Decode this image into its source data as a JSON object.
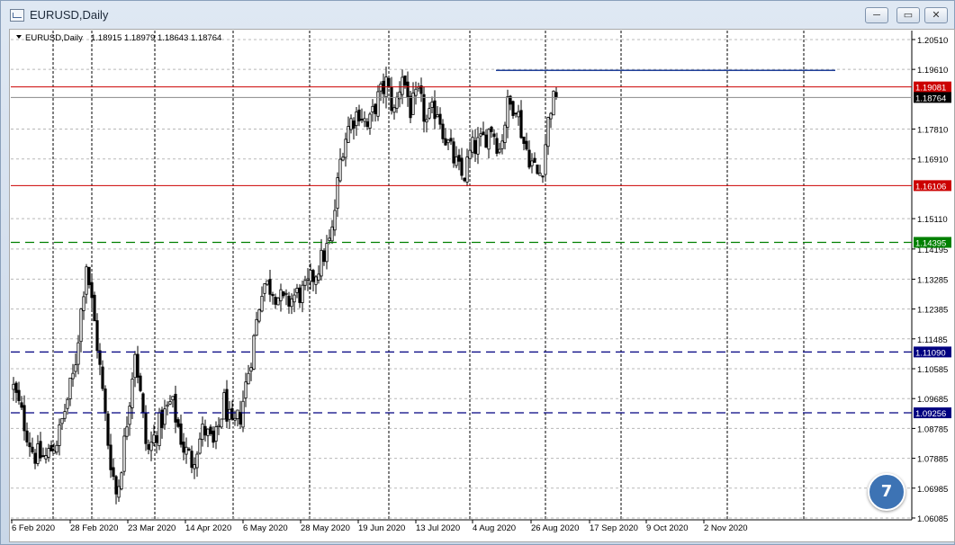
{
  "window": {
    "title": "EURUSD,Daily",
    "minimize_label": "─",
    "restore_label": "▭",
    "close_label": "✕"
  },
  "header": {
    "symbol": "EURUSD,Daily",
    "ohlc": "1.18915 1.18979 1.18643 1.18764"
  },
  "badge": {
    "label": "7"
  },
  "chart_data": {
    "type": "candlestick",
    "symbol": "EURUSD",
    "timeframe": "Daily",
    "last_bar": {
      "open": 1.18915,
      "high": 1.18979,
      "low": 1.18643,
      "close": 1.18764
    },
    "ylim": [
      1.0603,
      1.2078
    ],
    "y_ticks": [
      "1.20510",
      "1.19610",
      "1.17810",
      "1.16910",
      "1.15110",
      "1.14195",
      "1.13285",
      "1.12385",
      "1.11485",
      "1.10585",
      "1.09685",
      "1.08785",
      "1.07885",
      "1.06985",
      "1.06085"
    ],
    "x_ticks": [
      "6 Feb 2020",
      "28 Feb 2020",
      "23 Mar 2020",
      "14 Apr 2020",
      "6 May 2020",
      "28 May 2020",
      "19 Jun 2020",
      "13 Jul 2020",
      "4 Aug 2020",
      "26 Aug 2020",
      "17 Sep 2020",
      "9 Oct 2020",
      "2 Nov 2020"
    ],
    "bar_count": 202,
    "close_path": [
      [
        0,
        1.1
      ],
      [
        10,
        1.08
      ],
      [
        16,
        1.079
      ],
      [
        22,
        1.085
      ],
      [
        30,
        1.105
      ],
      [
        36,
        1.138
      ],
      [
        41,
        1.115
      ],
      [
        47,
        1.082
      ],
      [
        51,
        1.067
      ],
      [
        55,
        1.085
      ],
      [
        60,
        1.112
      ],
      [
        66,
        1.08
      ],
      [
        72,
        1.089
      ],
      [
        78,
        1.096
      ],
      [
        84,
        1.082
      ],
      [
        88,
        1.078
      ],
      [
        94,
        1.088
      ],
      [
        99,
        1.082
      ],
      [
        104,
        1.096
      ],
      [
        108,
        1.087
      ],
      [
        112,
        1.092
      ],
      [
        118,
        1.112
      ],
      [
        123,
        1.132
      ],
      [
        128,
        1.13
      ],
      [
        134,
        1.125
      ],
      [
        139,
        1.128
      ],
      [
        144,
        1.129
      ],
      [
        150,
        1.136
      ],
      [
        157,
        1.145
      ],
      [
        162,
        1.172
      ],
      [
        166,
        1.18
      ],
      [
        171,
        1.184
      ],
      [
        175,
        1.178
      ],
      [
        179,
        1.186
      ],
      [
        184,
        1.192
      ],
      [
        188,
        1.183
      ],
      [
        192,
        1.195
      ],
      [
        196,
        1.184
      ],
      [
        200,
        1.188
      ],
      [
        204,
        1.18
      ],
      [
        209,
        1.185
      ],
      [
        213,
        1.176
      ],
      [
        218,
        1.168
      ],
      [
        222,
        1.163
      ],
      [
        226,
        1.172
      ],
      [
        231,
        1.174
      ],
      [
        236,
        1.179
      ],
      [
        240,
        1.172
      ],
      [
        244,
        1.185
      ],
      [
        248,
        1.186
      ],
      [
        252,
        1.174
      ],
      [
        256,
        1.168
      ],
      [
        259,
        1.164
      ],
      [
        261,
        1.166
      ],
      [
        265,
        1.185
      ],
      [
        268,
        1.1876
      ]
    ],
    "horizontal_lines": [
      {
        "price": 1.19081,
        "label": "1.19081",
        "color": "#cc0000",
        "style": "solid"
      },
      {
        "price": 1.16106,
        "label": "1.16106",
        "color": "#cc0000",
        "style": "solid"
      },
      {
        "price": 1.14395,
        "label": "1.14395",
        "color": "#008000",
        "style": "dashed"
      },
      {
        "price": 1.1109,
        "label": "1.11090",
        "color": "#000080",
        "style": "dashed"
      },
      {
        "price": 1.09256,
        "label": "1.09256",
        "color": "#000080",
        "style": "dashed"
      }
    ],
    "current_price": {
      "price": 1.18764,
      "label": "1.18764"
    },
    "resistance_line": {
      "price": 1.1958,
      "color": "#1f3f99"
    },
    "colors": {
      "up": "#ffffff",
      "down": "#000000",
      "wick": "#000000",
      "grid": "#b8b8b8",
      "background": "#ffffff"
    }
  }
}
